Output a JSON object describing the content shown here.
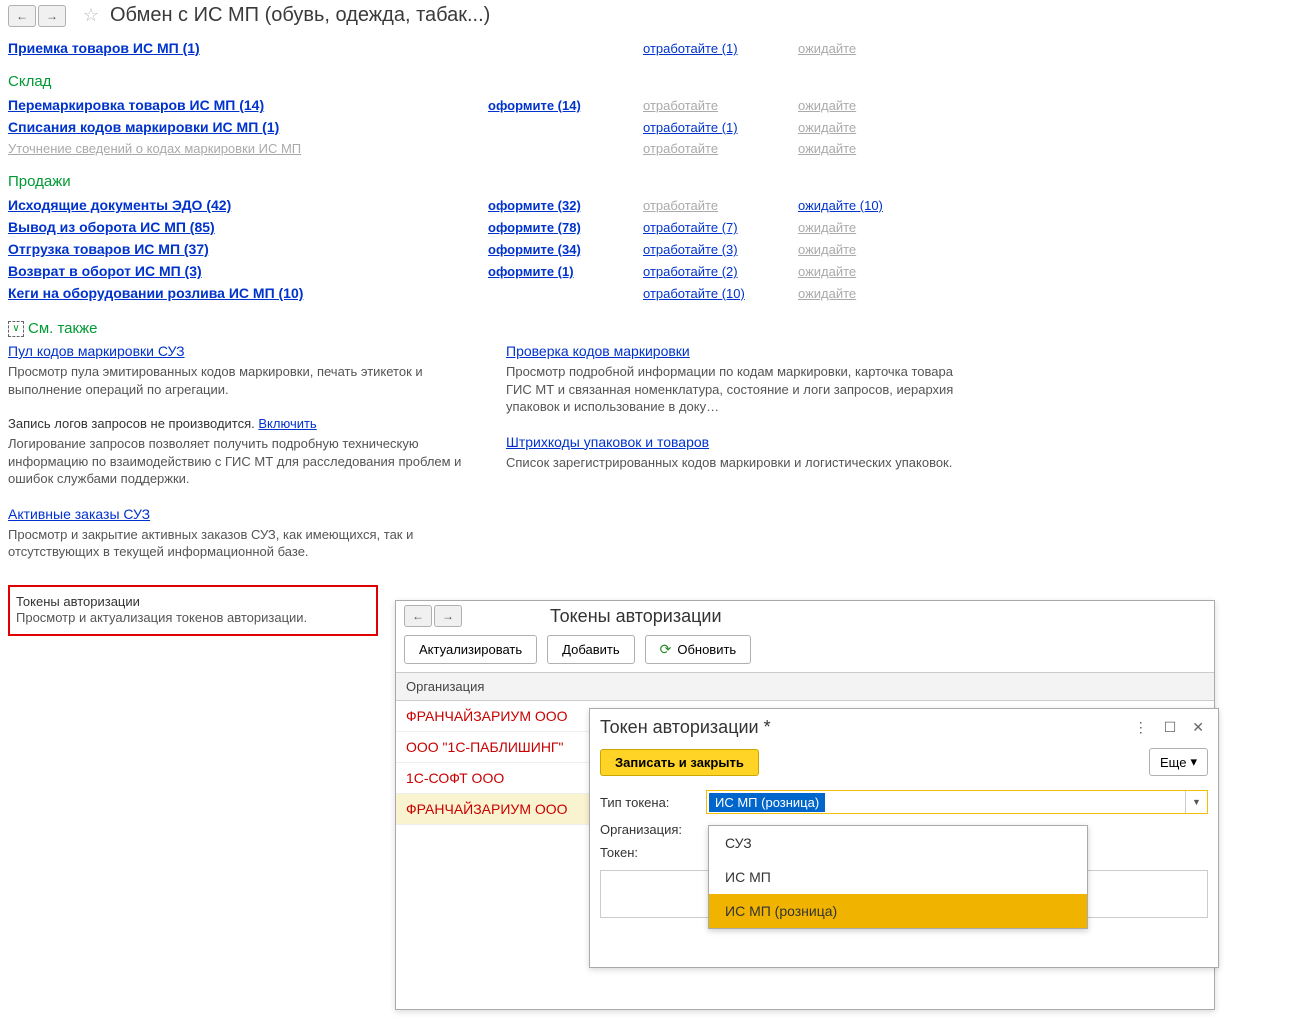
{
  "header": {
    "title": "Обмен с ИС МП (обувь, одежда, табак...)"
  },
  "priemka": {
    "main": "Приемка товаров ИС МП (1)",
    "otr": "отработайте (1)",
    "ozh": "ожидайте"
  },
  "sections": {
    "sklad": {
      "title": "Склад",
      "rows": [
        {
          "main": "Перемаркировка товаров ИС МП (14)",
          "oform": "оформите (14)",
          "otr": "отработайте",
          "otr_d": true,
          "ozh": "ожидайте",
          "ozh_d": true
        },
        {
          "main": "Списания кодов маркировки ИС МП (1)",
          "oform": "",
          "otr": "отработайте (1)",
          "ozh": "ожидайте",
          "ozh_d": true
        },
        {
          "main": "Уточнение сведений о кодах маркировки ИС МП",
          "main_d": true,
          "oform": "",
          "otr": "отработайте",
          "otr_d": true,
          "ozh": "ожидайте",
          "ozh_d": true
        }
      ]
    },
    "prodazhi": {
      "title": "Продажи",
      "rows": [
        {
          "main": "Исходящие документы ЭДО (42)",
          "oform": "оформите (32)",
          "otr": "отработайте",
          "otr_d": true,
          "ozh": "ожидайте (10)"
        },
        {
          "main": "Вывод из оборота ИС МП (85)",
          "oform": "оформите (78)",
          "otr": "отработайте (7)",
          "ozh": "ожидайте",
          "ozh_d": true
        },
        {
          "main": "Отгрузка товаров ИС МП (37)",
          "oform": "оформите (34)",
          "otr": "отработайте (3)",
          "ozh": "ожидайте",
          "ozh_d": true
        },
        {
          "main": "Возврат в оборот ИС МП (3)",
          "oform": "оформите (1)",
          "otr": "отработайте (2)",
          "ozh": "ожидайте",
          "ozh_d": true
        },
        {
          "main": "Кеги на оборудовании розлива ИС МП (10)",
          "oform": "",
          "otr": "отработайте (10)",
          "ozh": "ожидайте",
          "ozh_d": true
        }
      ]
    }
  },
  "also": {
    "title": "См. также",
    "left": [
      {
        "head": "Пул кодов маркировки СУЗ",
        "desc": "Просмотр пула эмитированных кодов маркировки, печать этикеток и выполнение операций по агрегации."
      },
      {
        "plain_prefix": "Запись логов запросов не производится. ",
        "inline_link": "Включить",
        "desc": "Логирование запросов позволяет получить подробную техническую информацию по взаимодействию с ГИС МТ для расследования проблем и ошибок службами поддержки."
      },
      {
        "head": "Активные заказы СУЗ",
        "desc": "Просмотр и закрытие активных заказов СУЗ, как имеющихся, так и отсутствующих в текущей информационной базе."
      },
      {
        "head": "Токены авторизации",
        "desc": "Просмотр и актуализация токенов авторизации.",
        "highlight": true
      }
    ],
    "right": [
      {
        "head": "Проверка кодов маркировки",
        "desc": "Просмотр подробной информации по кодам маркировки, карточка товара ГИС МТ и связанная номенклатура, состояние и логи запросов, иерархия упаковок и использование в доку…"
      },
      {
        "head": "Штрихкоды упаковок и товаров",
        "desc": "Список зарегистрированных кодов маркировки и логистических упаковок."
      }
    ]
  },
  "tokens_window": {
    "title": "Токены авторизации",
    "buttons": {
      "actualize": "Актуализировать",
      "add": "Добавить",
      "refresh": "Обновить"
    },
    "column": "Организация",
    "rows": [
      "ФРАНЧАЙЗАРИУМ ООО",
      "ООО \"1С-ПАБЛИШИНГ\"",
      "1С-СОФТ ООО",
      "ФРАНЧАЙЗАРИУМ ООО"
    ]
  },
  "token_detail": {
    "title": "Токен авторизации *",
    "save": "Записать и закрыть",
    "more": "Еще",
    "labels": {
      "type": "Тип токена:",
      "org": "Организация:",
      "token": "Токен:"
    },
    "type_value": "ИС МП (розница)",
    "dropdown": [
      "СУЗ",
      "ИС МП",
      "ИС МП (розница)"
    ],
    "selected": 2
  }
}
